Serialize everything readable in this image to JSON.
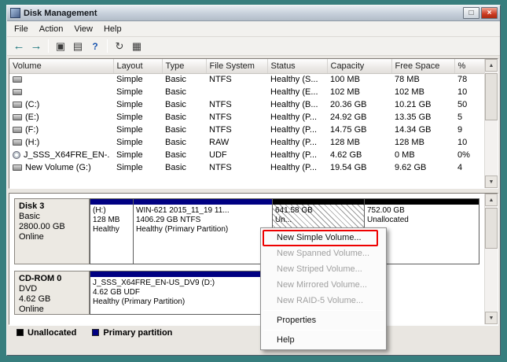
{
  "window": {
    "title": "Disk Management"
  },
  "icons": {
    "maximize": "□",
    "close": "×",
    "back": "←",
    "forward": "→",
    "console_tree": "▣",
    "properties_sheet": "▤",
    "help": "?",
    "refresh": "↻",
    "rescan": "▦",
    "scroll_up": "▲",
    "scroll_down": "▼"
  },
  "menubar": {
    "file": "File",
    "action": "Action",
    "view": "View",
    "help": "Help"
  },
  "volume_list": {
    "columns": [
      "Volume",
      "Layout",
      "Type",
      "File System",
      "Status",
      "Capacity",
      "Free Space",
      "%"
    ],
    "rows": [
      {
        "icon": "disk",
        "volume": "",
        "layout": "Simple",
        "type": "Basic",
        "fs": "NTFS",
        "status": "Healthy (S...",
        "capacity": "100 MB",
        "free": "78 MB",
        "pct": "78"
      },
      {
        "icon": "disk",
        "volume": "",
        "layout": "Simple",
        "type": "Basic",
        "fs": "",
        "status": "Healthy (E...",
        "capacity": "102 MB",
        "free": "102 MB",
        "pct": "10"
      },
      {
        "icon": "disk",
        "volume": "(C:)",
        "layout": "Simple",
        "type": "Basic",
        "fs": "NTFS",
        "status": "Healthy (B...",
        "capacity": "20.36 GB",
        "free": "10.21 GB",
        "pct": "50"
      },
      {
        "icon": "disk",
        "volume": "(E:)",
        "layout": "Simple",
        "type": "Basic",
        "fs": "NTFS",
        "status": "Healthy (P...",
        "capacity": "24.92 GB",
        "free": "13.35 GB",
        "pct": "5"
      },
      {
        "icon": "disk",
        "volume": "(F:)",
        "layout": "Simple",
        "type": "Basic",
        "fs": "NTFS",
        "status": "Healthy (P...",
        "capacity": "14.75 GB",
        "free": "14.34 GB",
        "pct": "9"
      },
      {
        "icon": "disk",
        "volume": "(H:)",
        "layout": "Simple",
        "type": "Basic",
        "fs": "RAW",
        "status": "Healthy (P...",
        "capacity": "128 MB",
        "free": "128 MB",
        "pct": "10"
      },
      {
        "icon": "cd",
        "volume": "J_SSS_X64FRE_EN-...",
        "layout": "Simple",
        "type": "Basic",
        "fs": "UDF",
        "status": "Healthy (P...",
        "capacity": "4.62 GB",
        "free": "0 MB",
        "pct": "0%"
      },
      {
        "icon": "disk",
        "volume": "New Volume (G:)",
        "layout": "Simple",
        "type": "Basic",
        "fs": "NTFS",
        "status": "Healthy (P...",
        "capacity": "19.54 GB",
        "free": "9.62 GB",
        "pct": "4"
      }
    ]
  },
  "graph": {
    "disks": [
      {
        "name": "Disk 3",
        "type": "Basic",
        "size": "2800.00 GB",
        "status": "Online",
        "partitions": [
          {
            "title": "(H:)",
            "detail": "128 MB",
            "status": "Healthy",
            "kind": "primary"
          },
          {
            "title": "WIN-621 2015_11_19 11...",
            "detail": "1406.29 GB NTFS",
            "status": "Healthy (Primary Partition)",
            "kind": "primary"
          },
          {
            "title": "641.58 GB",
            "detail": "Un...",
            "status": "",
            "kind": "unallocated-selected"
          },
          {
            "title": "752.00 GB",
            "detail": "Unallocated",
            "status": "",
            "kind": "unallocated"
          }
        ]
      },
      {
        "name": "CD-ROM 0",
        "type": "DVD",
        "size": "4.62 GB",
        "status": "Online",
        "partitions": [
          {
            "title": "J_SSS_X64FRE_EN-US_DV9 (D:)",
            "detail": "4.62 GB UDF",
            "status": "Healthy (Primary Partition)",
            "kind": "primary"
          }
        ]
      }
    ]
  },
  "legend": {
    "unallocated": {
      "label": "Unallocated",
      "color": "#000000"
    },
    "primary": {
      "label": "Primary partition",
      "color": "#000082"
    }
  },
  "context_menu": {
    "new_simple": "New Simple Volume...",
    "new_spanned": "New Spanned Volume...",
    "new_striped": "New Striped Volume...",
    "new_mirrored": "New Mirrored Volume...",
    "new_raid5": "New RAID-5 Volume...",
    "properties": "Properties",
    "help": "Help"
  },
  "annotation": {
    "color": "#ee0000"
  }
}
